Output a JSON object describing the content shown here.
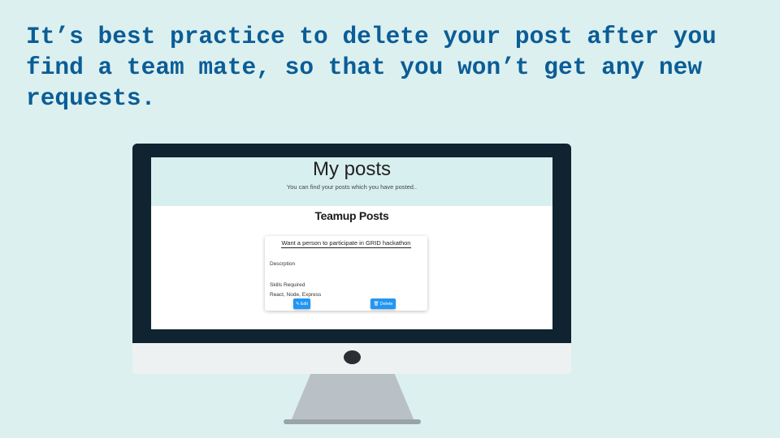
{
  "headline": "It’s best practice to delete your post after you find a team mate, so that you won’t get any new requests.",
  "screen": {
    "page_title": "My posts",
    "page_subtitle": "You can find your posts which you have posted..",
    "section_title": "Teamup Posts",
    "post": {
      "title": "Want a person to participate in GRID hackathon",
      "description_label": "Descrption",
      "skills_label": "Skills Required",
      "skills_value": "React, Node, Express",
      "edit_label": "Edit",
      "edit_icon": "edit-icon",
      "delete_label": "Delete",
      "delete_icon": "trash-icon"
    }
  },
  "colors": {
    "background": "#dcf0f0",
    "headline": "#0b5d96",
    "button": "#2196f3",
    "monitor_frame": "#0f2430"
  }
}
